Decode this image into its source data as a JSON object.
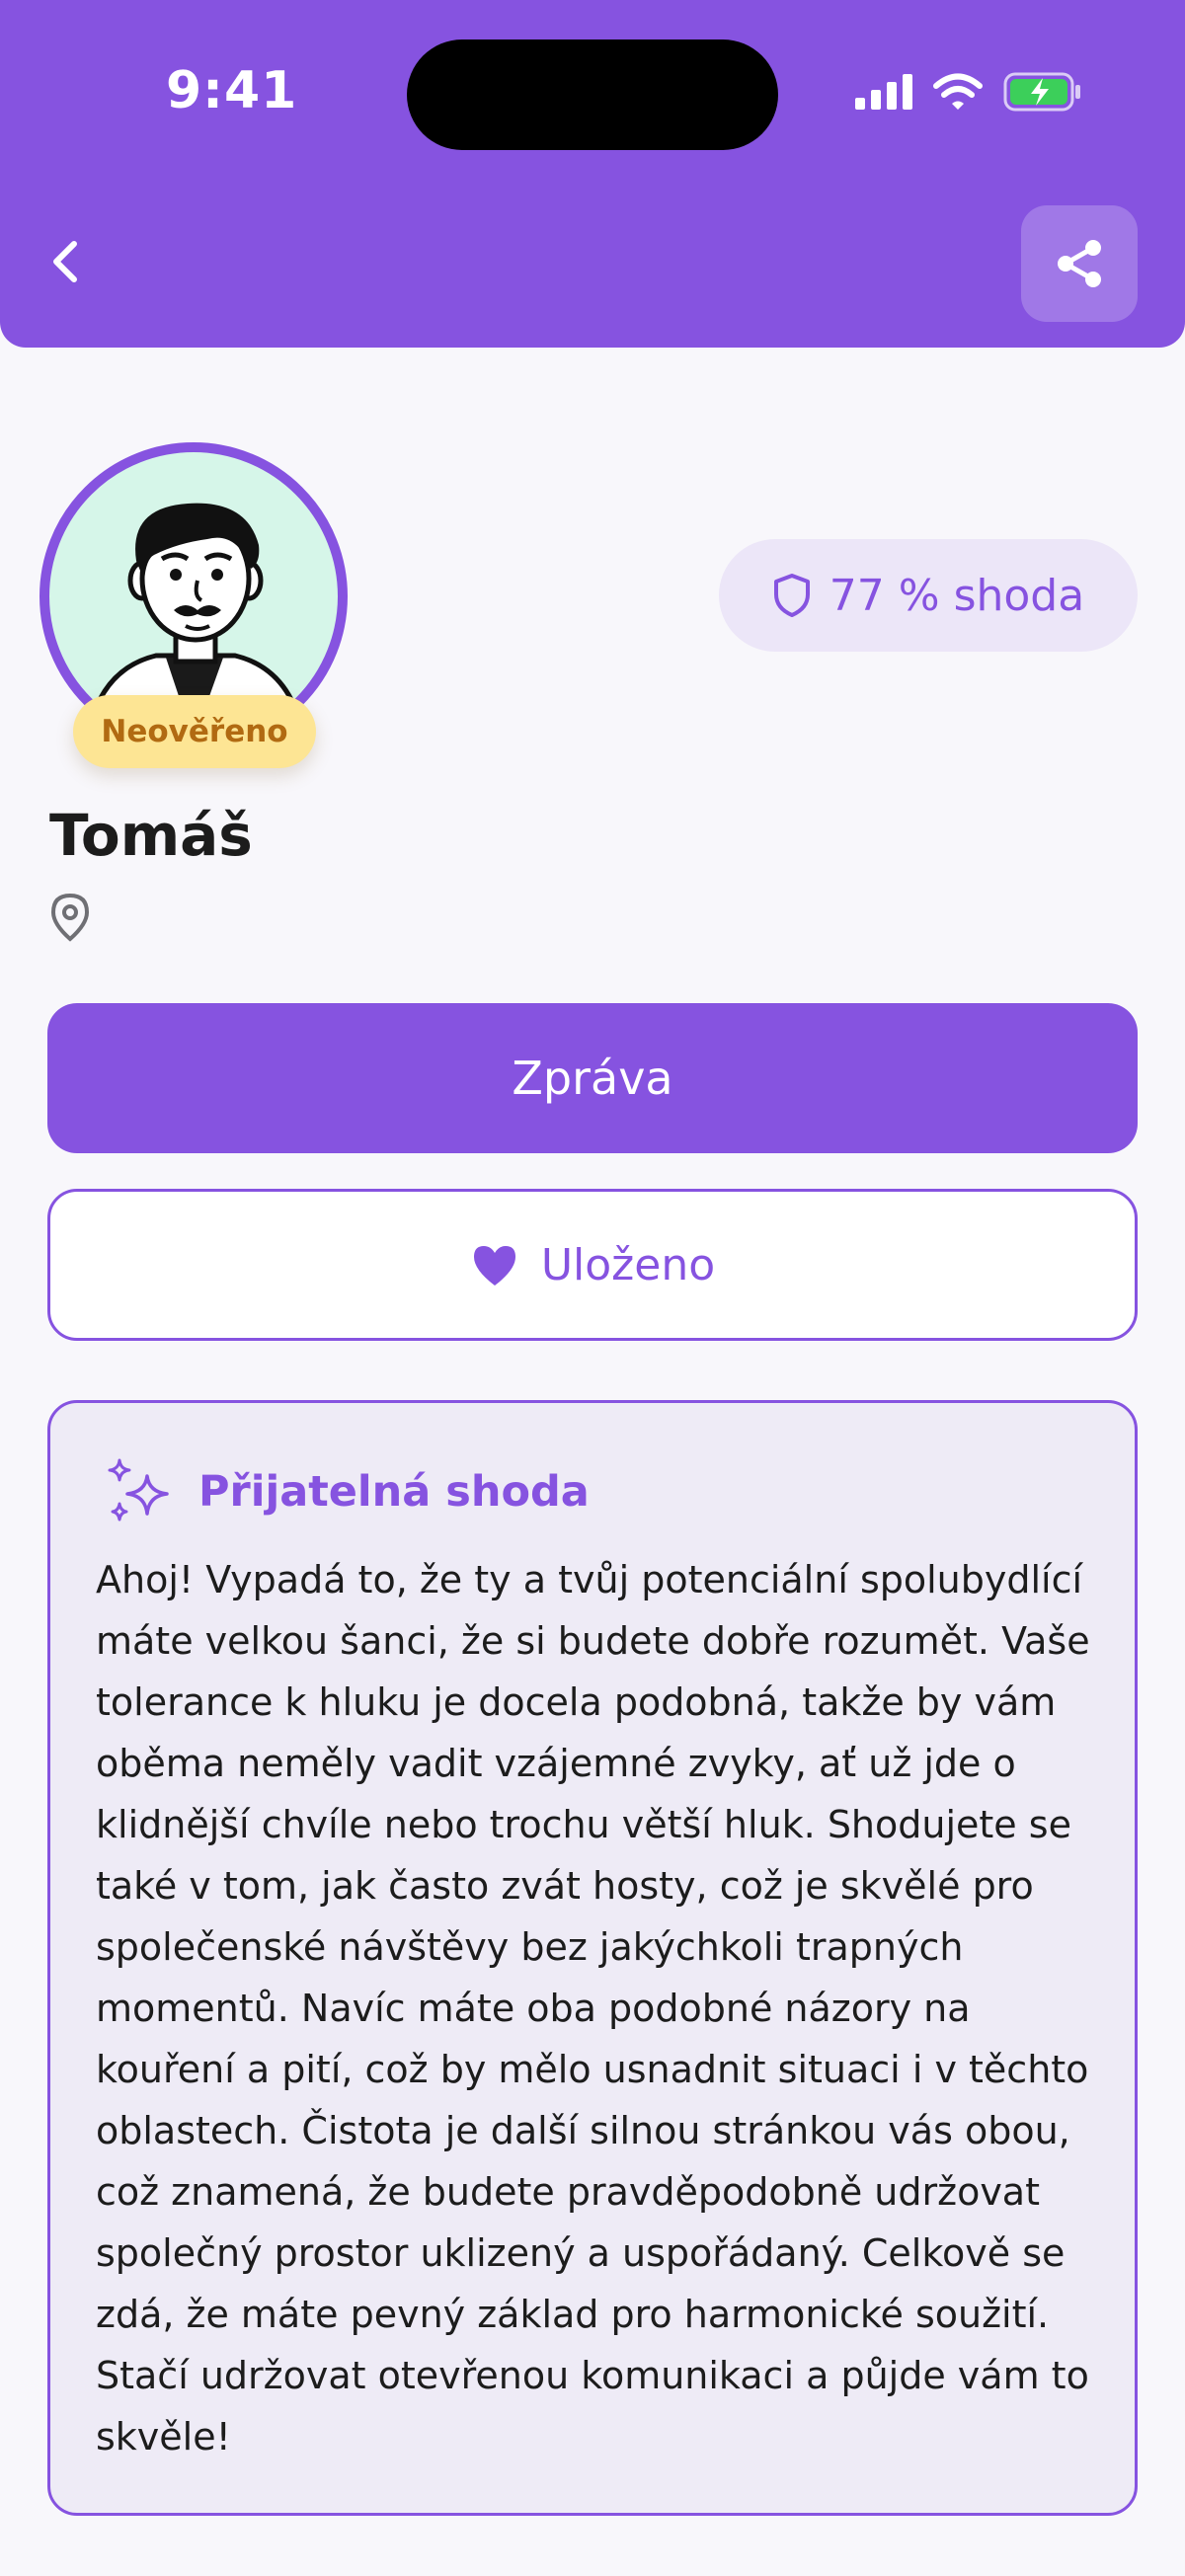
{
  "status_bar": {
    "time": "9:41"
  },
  "header": {
    "back_icon": "chevron-left-icon",
    "share_icon": "share-icon",
    "accent": "#8653e0"
  },
  "profile": {
    "name": "Tomáš",
    "verification_badge": "Neověřeno",
    "match_label": "77 % shoda",
    "avatar_icon": "avatar-illustration"
  },
  "actions": {
    "message_label": "Zpráva",
    "saved_label": "Uloženo"
  },
  "match_card": {
    "title": "Přijatelná shoda",
    "icon": "sparkles-icon",
    "text": "Ahoj! Vypadá to, že ty a tvůj potenciální spolubydlící máte velkou šanci, že si budete dobře rozumět. Vaše tolerance k hluku je docela podobná, takže by vám oběma neměly vadit vzájemné zvyky, ať už jde o klidnější chvíle nebo trochu větší hluk. Shodujete se také v tom, jak často zvát hosty, což je skvělé pro společenské návštěvy bez jakýchkoli trapných momentů. Navíc máte oba podobné názory na kouření a pití, což by mělo usnadnit situaci i v těchto oblastech. Čistota je další silnou stránkou vás obou, což znamená, že budete pravděpodobně udržovat společný prostor uklizený a uspořádaný. Celkově se zdá, že máte pevný základ pro harmonické soužití. Stačí udržovat otevřenou komunikaci a půjde vám to skvěle!"
  }
}
